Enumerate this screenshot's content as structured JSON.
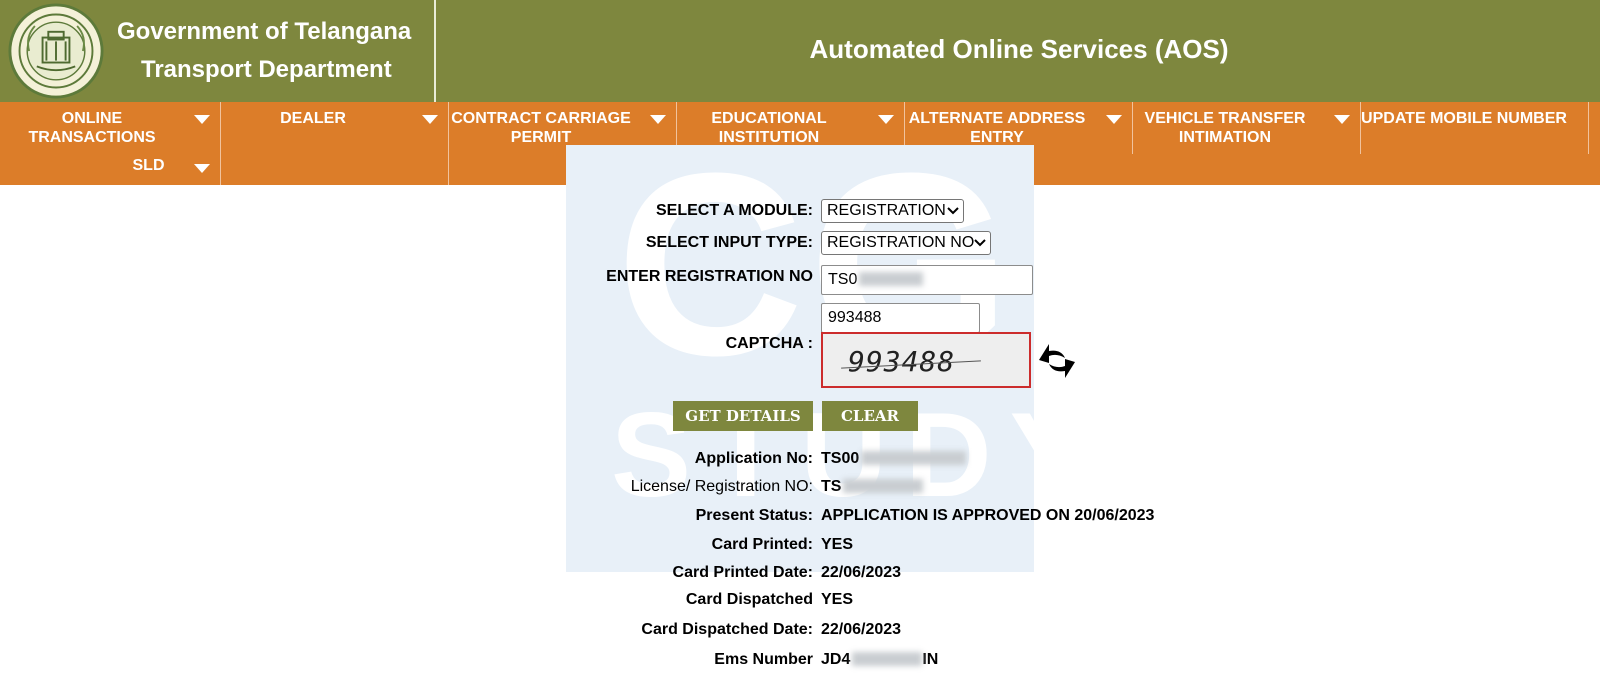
{
  "header": {
    "brand_line1": "Government of Telangana",
    "brand_line2": "Transport Department",
    "title": "Automated Online Services (AOS)"
  },
  "nav": {
    "items": [
      {
        "label": "ONLINE TRANSACTIONS"
      },
      {
        "label": "DEALER"
      },
      {
        "label": "CONTRACT CARRIAGE PERMIT"
      },
      {
        "label": "EDUCATIONAL INSTITUTION"
      },
      {
        "label": "ALTERNATE ADDRESS ENTRY"
      },
      {
        "label": "VEHICLE TRANSFER INTIMATION"
      },
      {
        "label": "UPDATE MOBILE NUMBER"
      }
    ],
    "sub_item": "SLD"
  },
  "watermark": {
    "line1": "CG",
    "line2": "STUDY"
  },
  "form": {
    "module_label": "SELECT A MODULE:",
    "module_value": "REGISTRATION",
    "input_type_label": "SELECT INPUT TYPE:",
    "input_type_value": "REGISTRATION NO",
    "reg_label": "ENTER REGISTRATION NO",
    "reg_value_prefix": "TS0",
    "captcha_input_value": "993488",
    "captcha_label": "CAPTCHA :",
    "captcha_image_text": "993488",
    "get_details_label": "GET DETAILS",
    "clear_label": "CLEAR"
  },
  "result": {
    "rows": [
      {
        "label": "Application No:",
        "value": "TS00"
      },
      {
        "label": "License/ Registration NO:",
        "value": "TS"
      },
      {
        "label": "Present Status:",
        "value": "APPLICATION IS APPROVED ON 20/06/2023"
      },
      {
        "label": "Card Printed:",
        "value": "YES"
      },
      {
        "label": "Card Printed Date:",
        "value": "22/06/2023"
      },
      {
        "label": "Card Dispatched",
        "value": "YES"
      },
      {
        "label": "Card Dispatched Date:",
        "value": "22/06/2023"
      },
      {
        "label": "Ems Number",
        "value": "JD4",
        "value_suffix": "IN"
      }
    ]
  },
  "colors": {
    "header_bg": "#7e873e",
    "nav_bg": "#dc7d29",
    "button_bg": "#7e873e",
    "captcha_border": "#cc2c2c",
    "watermark_bg": "#e8f0f8"
  }
}
